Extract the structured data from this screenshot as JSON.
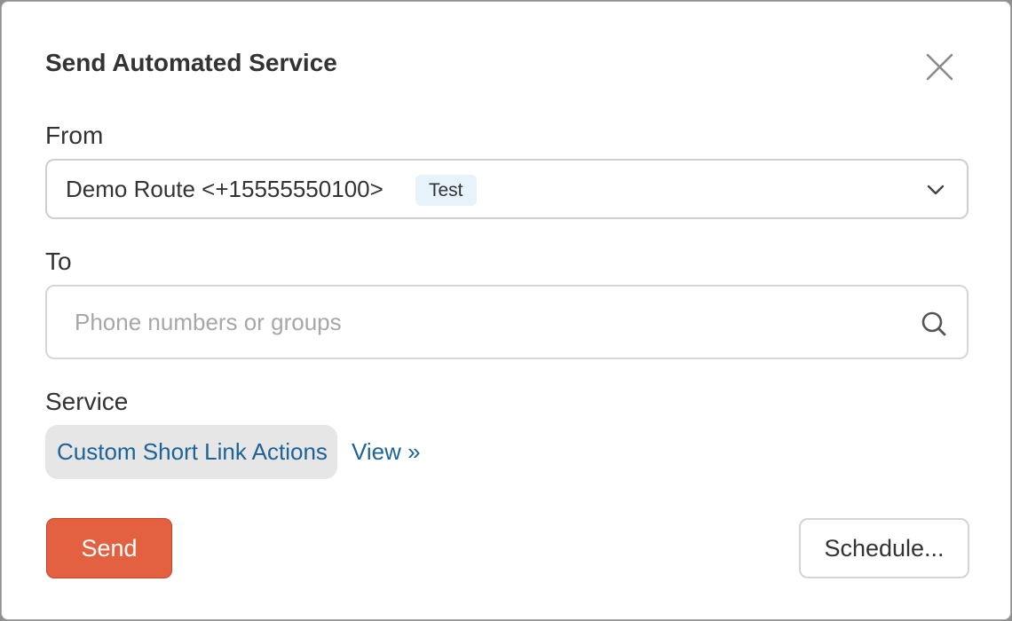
{
  "dialog": {
    "title": "Send Automated Service",
    "close_icon": "close-icon"
  },
  "from": {
    "label": "From",
    "selected_value": "Demo Route <+15555550100>",
    "badge": "Test",
    "dropdown_icon": "chevron-down-icon"
  },
  "to": {
    "label": "To",
    "value": "",
    "placeholder": "Phone numbers or groups",
    "icon": "search-icon"
  },
  "service": {
    "label": "Service",
    "selected": "Custom Short Link Actions",
    "view_link": "View »"
  },
  "actions": {
    "send_label": "Send",
    "schedule_label": "Schedule..."
  },
  "colors": {
    "primary_button": "#e36140",
    "link": "#1d6396",
    "badge_bg": "#e6f3fb",
    "chip_bg": "#e6e6e6"
  }
}
